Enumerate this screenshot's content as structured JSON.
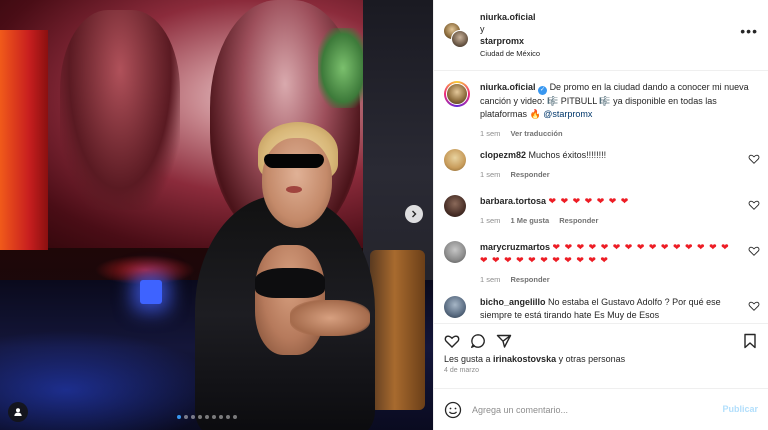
{
  "header": {
    "username": "niurka.oficial",
    "connector": "y",
    "collab_username": "starpromx",
    "location": "Ciudad de México"
  },
  "caption": {
    "username": "niurka.oficial",
    "text": "De promo en la ciudad dando a conocer mi nueva canción y video: 🎼 PITBULL 🎼 ya disponible en todas las plataformas 🔥",
    "mention": "@starpromx",
    "time": "1 sem",
    "see_translation": "Ver traducción"
  },
  "comments": [
    {
      "username": "clopezm82",
      "text": "Muchos éxitos!!!!!!!!",
      "time": "1 sem",
      "reply": "Responder",
      "likes": ""
    },
    {
      "username": "barbara.tortosa",
      "text": "❤ ❤ ❤ ❤ ❤ ❤ ❤",
      "time": "1 sem",
      "likes": "1 Me gusta",
      "reply": "Responder"
    },
    {
      "username": "marycruzmartos",
      "text": "❤ ❤ ❤ ❤ ❤ ❤ ❤ ❤ ❤ ❤ ❤ ❤ ❤ ❤ ❤ ❤ ❤ ❤ ❤ ❤ ❤ ❤ ❤ ❤ ❤ ❤",
      "time": "1 sem",
      "reply": "Responder",
      "likes": ""
    },
    {
      "username": "bicho_angelillo",
      "text": "No estaba el Gustavo Adolfo ? Por qué ese siempre te está tirando hate Es Muy de Esos",
      "time": "",
      "reply": "",
      "likes": ""
    }
  ],
  "likes": {
    "prefix": "Les gusta a ",
    "user": "irinakostovska",
    "suffix": " y otras personas"
  },
  "date": "4 de marzo",
  "compose": {
    "placeholder": "Agrega un comentario...",
    "publish": "Publicar"
  },
  "carousel": {
    "total": 9,
    "active_index": 0
  },
  "icons": {
    "more": "more-options-icon",
    "next": "chevron-right-icon",
    "tag": "user-tag-icon",
    "like": "heart-icon",
    "comment": "comment-icon",
    "share": "share-icon",
    "save": "bookmark-icon",
    "emoji": "emoji-icon",
    "verified": "verified-badge-icon"
  },
  "colors": {
    "accent": "#3897f0",
    "publish_disabled": "#b2dffc",
    "heart_red": "#ed1c24",
    "muted": "#8e8e8e"
  }
}
